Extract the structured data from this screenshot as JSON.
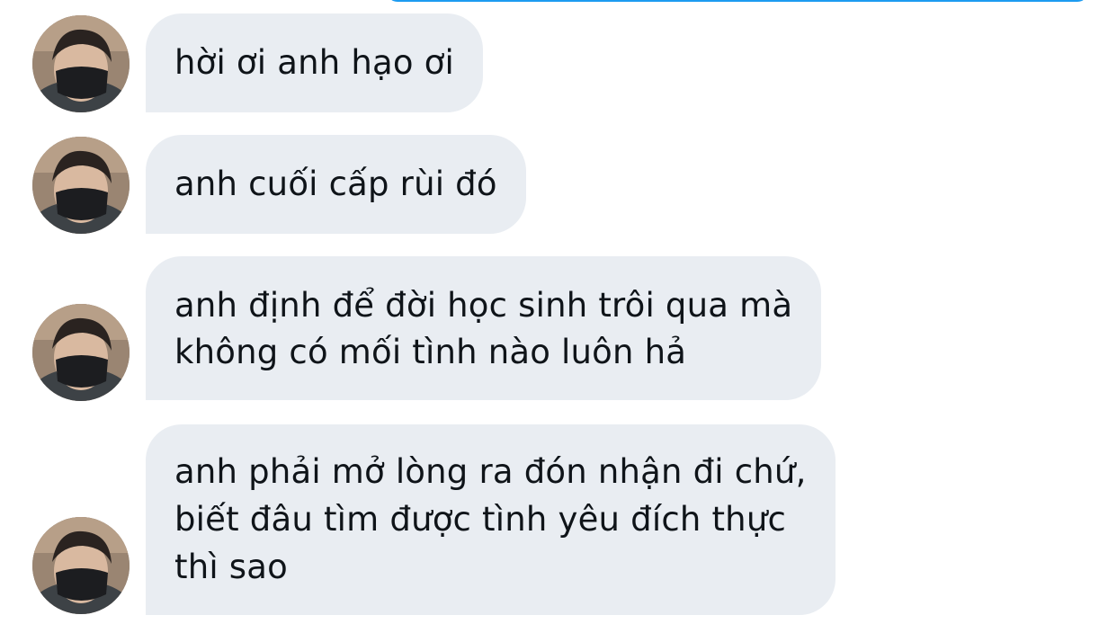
{
  "conversation": {
    "messages": [
      {
        "text": "hời ơi anh hạo ơi"
      },
      {
        "text": "anh cuối cấp rùi đó"
      },
      {
        "text": "anh định để đời học sinh trôi qua mà\nkhông có mối tình nào luôn hả"
      },
      {
        "text": "anh phải mở lòng ra đón nhận đi chứ,\nbiết đâu tìm được tình yêu đích thực\nthì sao"
      }
    ]
  },
  "colors": {
    "bubble_bg": "#e9edf2",
    "text": "#0f1419",
    "accent": "#1d9bf0"
  }
}
